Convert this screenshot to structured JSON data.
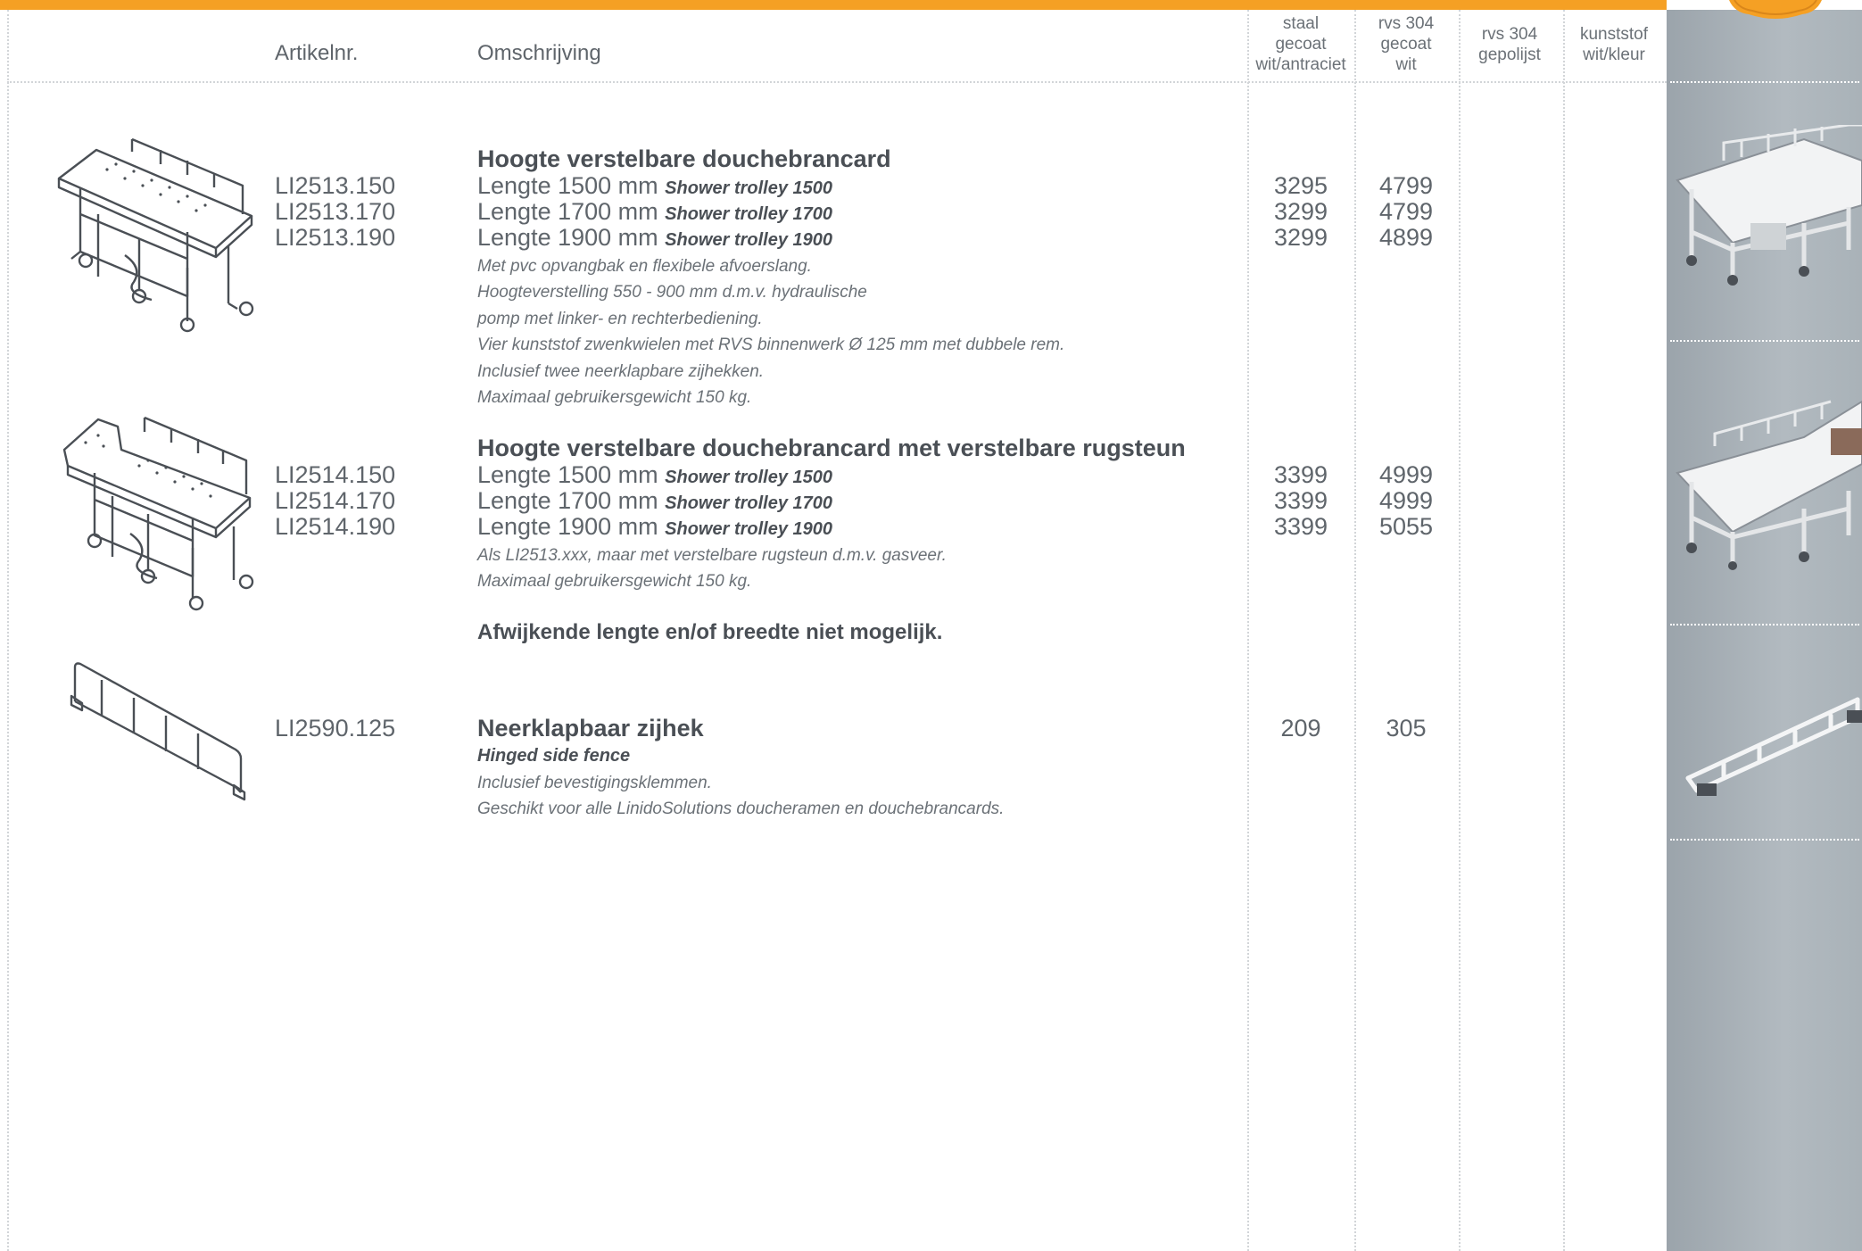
{
  "colors": {
    "accent": "#f5a024",
    "panel": "#a3acb3",
    "text": "#4a4f55"
  },
  "header": {
    "article_label": "Artikelnr.",
    "description_label": "Omschrijving",
    "columns": [
      "staal\ngecoat\nwit/antraciet",
      "rvs 304\ngecoat\nwit",
      "rvs 304\ngepolijst",
      "kunststof\nwit/kleur"
    ]
  },
  "products": [
    {
      "title": "Hoogte verstelbare douchebrancard",
      "codes": "LI2513.150\nLI2513.170\nLI2513.190",
      "variants": [
        {
          "label": "Lengte 1500 mm",
          "english": "Shower trolley 1500"
        },
        {
          "label": "Lengte 1700 mm",
          "english": "Shower trolley 1700"
        },
        {
          "label": "Lengte 1900 mm",
          "english": "Shower trolley 1900"
        }
      ],
      "prices_staal": "3295\n3299\n3299",
      "prices_rvs_gecoat": "4799\n4799\n4899",
      "description": [
        "Met pvc opvangbak en flexibele afvoerslang.",
        "Hoogteverstelling 550 - 900 mm d.m.v. hydraulische",
        "pomp met linker- en rechterbediening.",
        "Vier kunststof zwenkwielen met RVS binnenwerk Ø 125 mm met dubbele rem.",
        "Inclusief twee neerklapbare zijhekken.",
        "Maximaal gebruikersgewicht 150 kg."
      ],
      "image": "shower-trolley-drawing"
    },
    {
      "title": "Hoogte verstelbare douchebrancard met verstelbare rugsteun",
      "codes": "LI2514.150\nLI2514.170\nLI2514.190",
      "variants": [
        {
          "label": "Lengte 1500 mm",
          "english": "Shower trolley 1500"
        },
        {
          "label": "Lengte 1700 mm",
          "english": "Shower trolley 1700"
        },
        {
          "label": "Lengte 1900 mm",
          "english": "Shower trolley 1900"
        }
      ],
      "prices_staal": "3399\n3399\n3399",
      "prices_rvs_gecoat": "4999\n4999\n5055",
      "description": [
        "Als LI2513.xxx, maar met verstelbare rugsteun d.m.v. gasveer.",
        "Maximaal gebruikersgewicht 150 kg."
      ],
      "image": "shower-trolley-backrest-drawing"
    },
    {
      "title": "Neerklapbaar zijhek",
      "english": "Hinged side fence",
      "codes": "LI2590.125",
      "prices_staal": "209",
      "prices_rvs_gecoat": "305",
      "description": [
        "Inclusief bevestigingsklemmen.",
        "Geschikt voor alle LinidoSolutions doucheramen en douchebrancards."
      ],
      "image": "side-fence-drawing"
    }
  ],
  "note": "Afwijkende lengte en/of breedte niet mogelijk."
}
